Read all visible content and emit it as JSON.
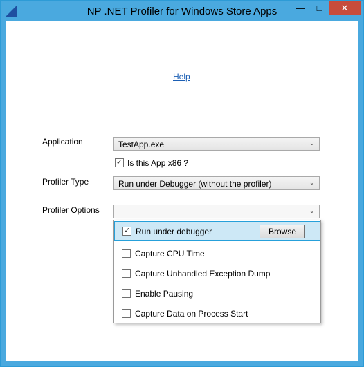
{
  "window": {
    "title": "NP .NET Profiler for Windows Store Apps",
    "minimize_icon": "minimize-icon",
    "maximize_icon": "maximize-icon",
    "close_icon": "close-icon"
  },
  "help": {
    "label": "Help"
  },
  "form": {
    "application_label": "Application",
    "application_value": "TestApp.exe",
    "is_x86_label": "Is this App x86 ?",
    "is_x86_checked": true,
    "profiler_type_label": "Profiler Type",
    "profiler_type_value": "Run under Debugger (without the profiler)",
    "profiler_options_label": "Profiler Options",
    "profiler_options_value": ""
  },
  "options": [
    {
      "label": "Run under debugger",
      "checked": true,
      "selected": true
    },
    {
      "label": "Capture CPU Time",
      "checked": false
    },
    {
      "label": "Capture Unhandled Exception Dump",
      "checked": false
    },
    {
      "label": "Enable Pausing",
      "checked": false
    },
    {
      "label": "Capture Data on Process Start",
      "checked": false
    }
  ],
  "browse_label": "Browse",
  "colors": {
    "titlebar": "#4aa9df",
    "close": "#c74c3c",
    "selection": "#cde8f6",
    "link": "#1c5fb4"
  }
}
